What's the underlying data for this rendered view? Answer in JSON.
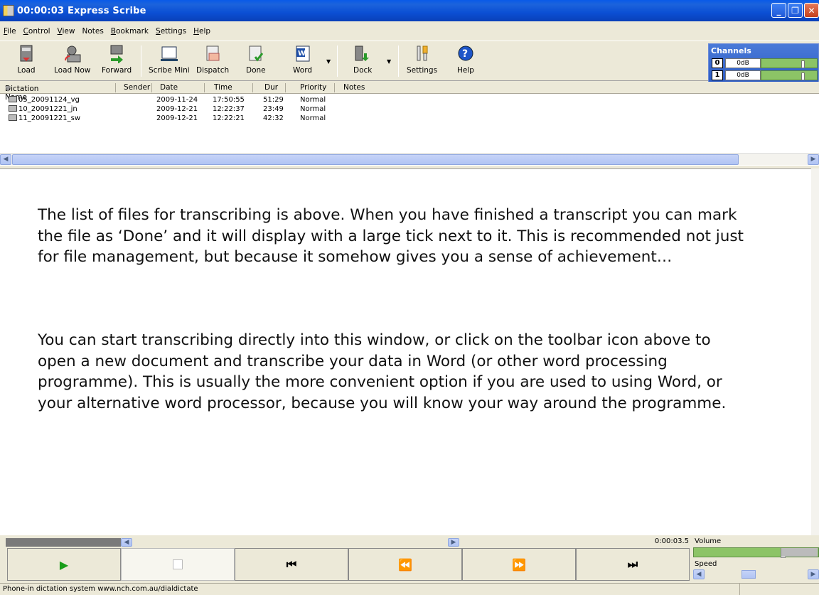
{
  "window": {
    "title": "00:00:03 Express Scribe"
  },
  "menu": [
    {
      "label": "File",
      "u": "F",
      "rest": "ile"
    },
    {
      "label": "Control",
      "u": "C",
      "rest": "ontrol"
    },
    {
      "label": "View",
      "u": "V",
      "rest": "iew"
    },
    {
      "label": "Notes",
      "u": "",
      "rest": "Notes"
    },
    {
      "label": "Bookmark",
      "u": "B",
      "rest": "ookmark"
    },
    {
      "label": "Settings",
      "u": "S",
      "rest": "ettings"
    },
    {
      "label": "Help",
      "u": "H",
      "rest": "elp"
    }
  ],
  "toolbar": {
    "load": "Load",
    "load_now": "Load Now",
    "forward": "Forward",
    "scribe_mini": "Scribe Mini",
    "dispatch": "Dispatch",
    "done": "Done",
    "word": "Word",
    "dock": "Dock",
    "settings": "Settings",
    "help": "Help"
  },
  "channels": {
    "title": "Channels",
    "rows": [
      {
        "num": "0",
        "value": "0dB"
      },
      {
        "num": "1",
        "value": "0dB"
      }
    ]
  },
  "columns": {
    "name": "Dictation Name",
    "sender": "Sender",
    "date": "Date",
    "time": "Time",
    "dur": "Dur",
    "priority": "Priority",
    "notes": "Notes"
  },
  "files": [
    {
      "name": "05_20091124_vg",
      "sender": "",
      "date": "2009-11-24",
      "time": "17:50:55",
      "dur": "51:29",
      "priority": "Normal"
    },
    {
      "name": "10_20091221_jn",
      "sender": "",
      "date": "2009-12-21",
      "time": "12:22:37",
      "dur": "23:49",
      "priority": "Normal"
    },
    {
      "name": "11_20091221_sw",
      "sender": "",
      "date": "2009-12-21",
      "time": "12:22:21",
      "dur": "42:32",
      "priority": "Normal"
    }
  ],
  "editor": {
    "p1": "The list of files for transcribing is above. When you have finished a transcript you can mark the file as ‘Done’ and it will display with a large tick next to it. This is recommended not just for file management, but because it somehow gives you a sense of achievement…",
    "p2": "You can start transcribing directly into this window, or click on the toolbar icon above to open a new document and transcribe your data in Word (or other word processing programme). This is usually the more convenient option if you are used to using Word, or your alternative word processor, because you will know your way around the programme."
  },
  "transport": {
    "time": "0:00:03.5",
    "volume_label": "Volume",
    "speed_label": "Speed",
    "volume_level": 0.7,
    "play": "▶",
    "stop": "",
    "to_start": "⏮",
    "rewind": "⏪",
    "fast_forward": "⏩",
    "to_end": "⏭"
  },
  "status": {
    "text": "Phone-in dictation system www.nch.com.au/dialdictate"
  },
  "colors": {
    "titlebar": "#0a5ae8",
    "play": "#1a9e1a",
    "level_green": "#8cc466"
  }
}
